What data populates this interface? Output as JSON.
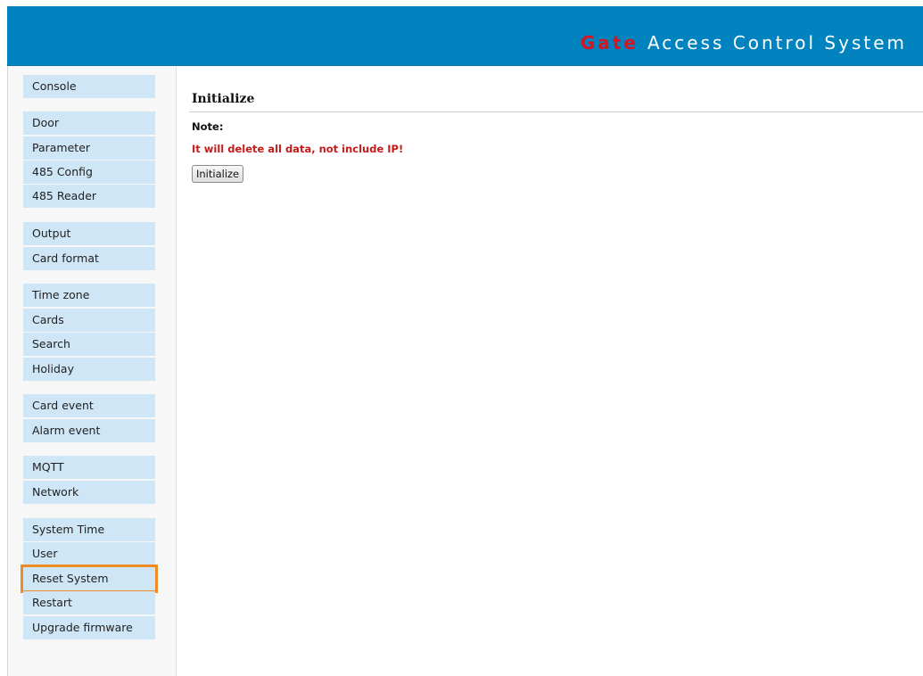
{
  "header": {
    "brand": "Gate",
    "title": "Access Control System"
  },
  "sidebar": {
    "items": [
      {
        "id": "console",
        "label": "Console"
      },
      {
        "id": "door",
        "label": "Door"
      },
      {
        "id": "parameter",
        "label": "Parameter"
      },
      {
        "id": "485-config",
        "label": "485 Config"
      },
      {
        "id": "485-reader",
        "label": "485 Reader"
      },
      {
        "id": "output",
        "label": "Output"
      },
      {
        "id": "card-format",
        "label": "Card format"
      },
      {
        "id": "time-zone",
        "label": "Time zone"
      },
      {
        "id": "cards",
        "label": "Cards"
      },
      {
        "id": "search",
        "label": "Search"
      },
      {
        "id": "holiday",
        "label": "Holiday"
      },
      {
        "id": "card-event",
        "label": "Card event"
      },
      {
        "id": "alarm-event",
        "label": "Alarm event"
      },
      {
        "id": "mqtt",
        "label": "MQTT"
      },
      {
        "id": "network",
        "label": "Network"
      },
      {
        "id": "system-time",
        "label": "System Time"
      },
      {
        "id": "user",
        "label": "User"
      },
      {
        "id": "reset-system",
        "label": "Reset System"
      },
      {
        "id": "restart",
        "label": "Restart"
      },
      {
        "id": "upgrade-firmware",
        "label": "Upgrade firmware"
      }
    ],
    "highlighted": "Reset System"
  },
  "main": {
    "title": "Initialize",
    "note_label": "Note:",
    "warning": "It will delete all data, not include IP!",
    "button_label": "Initialize"
  },
  "colors": {
    "header_bg": "#0083bf",
    "brand": "#d8141e",
    "nav_item_bg": "#cfe6f7",
    "highlight_outline": "#f08a24",
    "warning": "#c51a1a"
  }
}
